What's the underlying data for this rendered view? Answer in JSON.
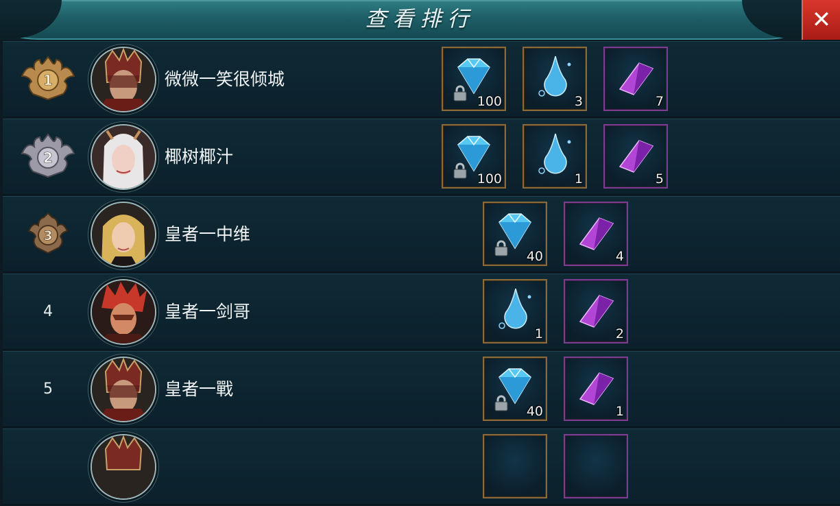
{
  "window": {
    "title": "查看排行"
  },
  "close": {
    "label": "✕"
  },
  "rows": [
    {
      "rank": "1",
      "medal": "gold",
      "name": "微微一笑很倾城",
      "portrait": "warrior-red-helmet",
      "rewards": [
        {
          "type": "bound-diamond",
          "qty": "100"
        },
        {
          "type": "water-drop",
          "qty": "3"
        },
        {
          "type": "purple-crystal",
          "qty": "7"
        }
      ]
    },
    {
      "rank": "2",
      "medal": "silver",
      "name": "椰树椰汁",
      "portrait": "white-haired-woman",
      "rewards": [
        {
          "type": "bound-diamond",
          "qty": "100"
        },
        {
          "type": "water-drop",
          "qty": "1"
        },
        {
          "type": "purple-crystal",
          "qty": "5"
        }
      ]
    },
    {
      "rank": "3",
      "medal": "bronze",
      "name": "皇者一中维",
      "portrait": "blonde-woman",
      "rewards": [
        {
          "type": "bound-diamond",
          "qty": "40"
        },
        {
          "type": "purple-crystal",
          "qty": "4"
        }
      ]
    },
    {
      "rank": "4",
      "medal": "none",
      "name": "皇者一剑哥",
      "portrait": "red-haired-man",
      "rewards": [
        {
          "type": "water-drop",
          "qty": "1"
        },
        {
          "type": "purple-crystal",
          "qty": "2"
        }
      ]
    },
    {
      "rank": "5",
      "medal": "none",
      "name": "皇者一戰",
      "portrait": "warrior-red-helmet",
      "rewards": [
        {
          "type": "bound-diamond",
          "qty": "40"
        },
        {
          "type": "purple-crystal",
          "qty": "1"
        }
      ]
    }
  ],
  "colors": {
    "gold_border": "#8a6a3a",
    "purple_border": "#7b3d8f",
    "close_bg": "#c82a22",
    "title_plate": "#2a7279"
  }
}
